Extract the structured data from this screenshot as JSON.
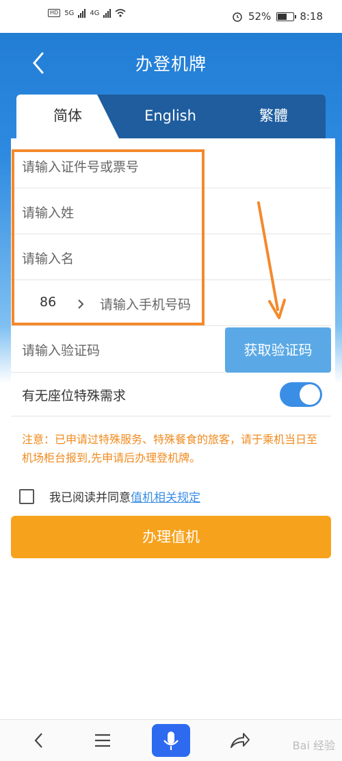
{
  "status_bar": {
    "network_hd1": "HD",
    "network_5g": "5G",
    "network_4g": "4G",
    "network_hd2": "HD",
    "battery": "52%",
    "time": "8:18"
  },
  "header": {
    "title": "办登机牌"
  },
  "tabs": [
    {
      "label": "简体",
      "active": true
    },
    {
      "label": "English",
      "active": false
    },
    {
      "label": "繁體",
      "active": false
    }
  ],
  "form": {
    "id_placeholder": "请输入证件号或票号",
    "surname_placeholder": "请输入姓",
    "given_name_placeholder": "请输入名",
    "country_code": "86",
    "phone_placeholder": "请输入手机号码",
    "code_placeholder": "请输入验证码",
    "get_code_button": "获取验证码",
    "seat_request_label": "有无座位特殊需求",
    "seat_request_on": true
  },
  "notice": "注意：已申请过特殊服务、特殊餐食的旅客，请于乘机当日至机场柜台报到,先申请后办理登机牌。",
  "agreement": {
    "prefix": "我已阅读并同意",
    "link": "值机相关规定",
    "checked": false
  },
  "submit_label": "办理值机",
  "watermark": "Bai 经验",
  "colors": {
    "primary_blue": "#1f79d1",
    "tab_dark": "#1f5d9e",
    "highlight_orange": "#f4892c",
    "submit_orange": "#f7a21c",
    "notice_orange": "#f08a1e"
  }
}
